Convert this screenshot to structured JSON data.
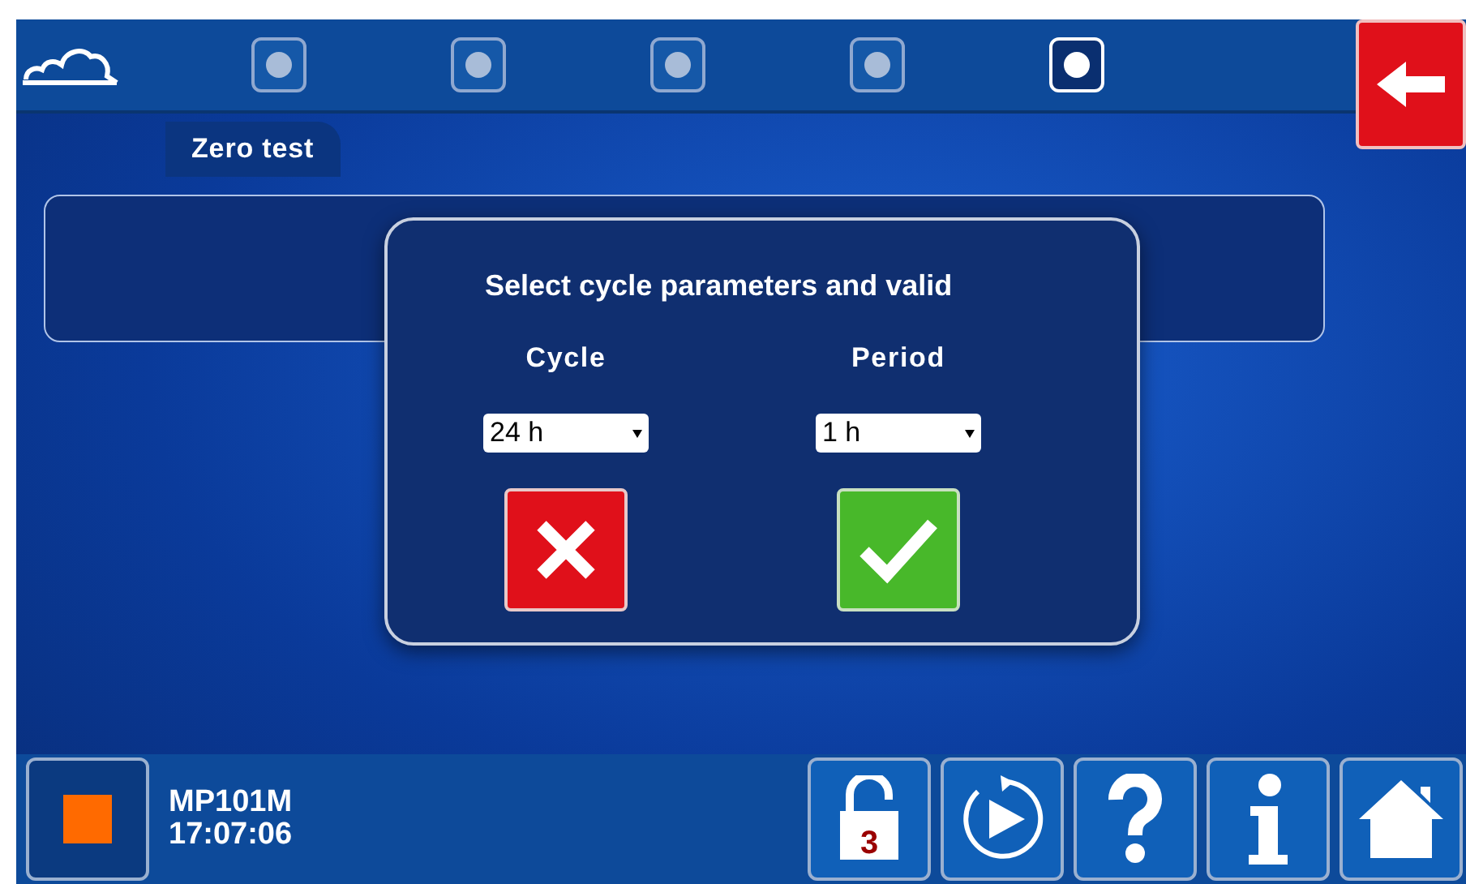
{
  "steps": [
    {
      "selected": false
    },
    {
      "selected": false
    },
    {
      "selected": false
    },
    {
      "selected": false
    },
    {
      "selected": true
    }
  ],
  "tab": {
    "label": "Zero test"
  },
  "dialog": {
    "title": "Select cycle parameters and valid",
    "fields": [
      {
        "label": "Cycle",
        "value": "24 h"
      },
      {
        "label": "Period",
        "value": "1 h"
      }
    ]
  },
  "status": {
    "device": "MP101M",
    "time": "17:07:06"
  },
  "lock_badge": "3"
}
